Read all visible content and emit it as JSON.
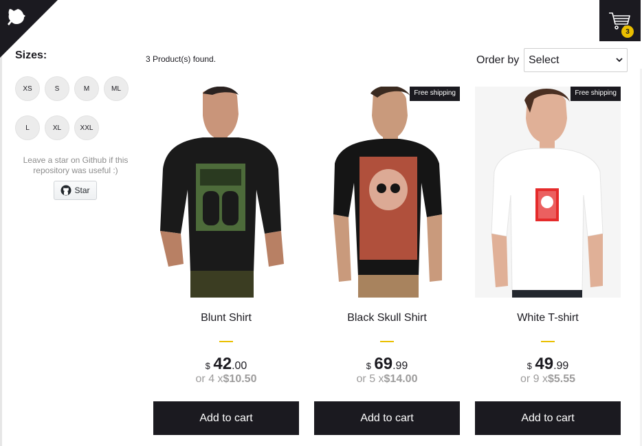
{
  "filters": {
    "title": "Sizes:",
    "sizes": [
      "XS",
      "S",
      "M",
      "ML",
      "L",
      "XL",
      "XXL"
    ]
  },
  "github": {
    "note": "Leave a star on Github if this repository was useful :)",
    "star_label": "Star"
  },
  "toolbar": {
    "products_found": "3 Product(s) found.",
    "order_label": "Order by",
    "order_selected": "Select"
  },
  "cart": {
    "count": "3"
  },
  "products": [
    {
      "title": "Blunt Shirt",
      "free_shipping": false,
      "shipping_label": "",
      "currency": "$",
      "price_int": "42",
      "price_dec": ".00",
      "installment_prefix": "or 4 x",
      "installment_value": "$10.50",
      "add_label": "Add to cart",
      "shirt_color": "#1a1a1a"
    },
    {
      "title": "Black Skull Shirt",
      "free_shipping": true,
      "shipping_label": "Free shipping",
      "currency": "$",
      "price_int": "69",
      "price_dec": ".99",
      "installment_prefix": "or 5 x",
      "installment_value": "$14.00",
      "add_label": "Add to cart",
      "shirt_color": "#151515"
    },
    {
      "title": "White T-shirt",
      "free_shipping": true,
      "shipping_label": "Free shipping",
      "currency": "$",
      "price_int": "49",
      "price_dec": ".99",
      "installment_prefix": "or 9 x",
      "installment_value": "$5.55",
      "add_label": "Add to cart",
      "shirt_color": "#f4f4f4"
    }
  ],
  "colors": {
    "dark": "#1b1a20",
    "accent": "#eabf00",
    "muted": "#9c9b9b"
  }
}
